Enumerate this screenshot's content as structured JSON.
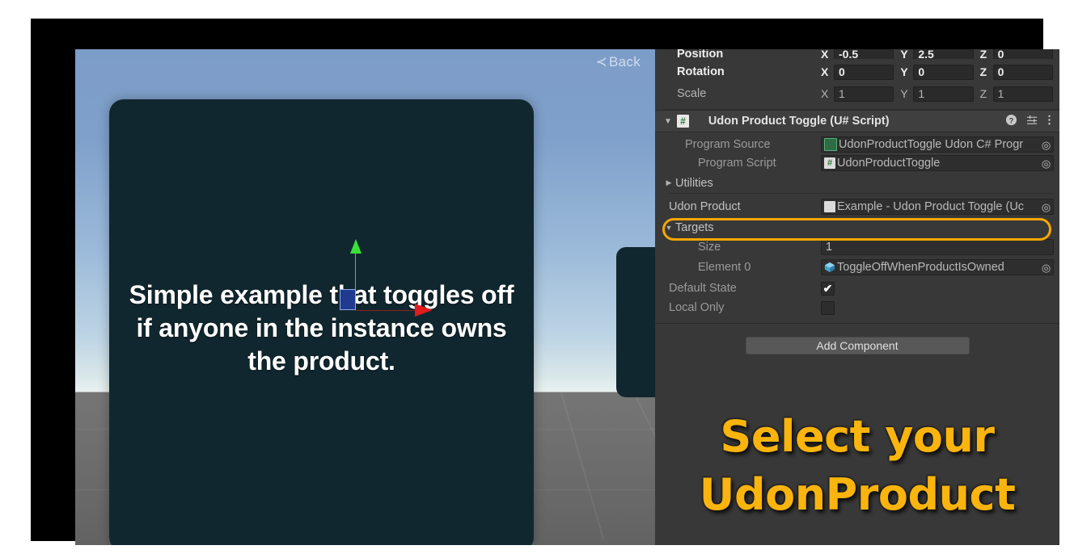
{
  "viewport": {
    "back_label": "Back",
    "back_chevron": "≺",
    "board_text": "Simple example that toggles off if anyone in the instance owns the product.",
    "gizmo": {
      "y_axis_color": "#3ae03a",
      "x_axis_color": "#e01c1c",
      "plane_color": "#1f3a8f"
    },
    "board_color": "#11272f",
    "sky_top_color": "#7d9dc9",
    "ground_color": "#6e6e6e"
  },
  "inspector": {
    "transform": {
      "rows": [
        {
          "label": "Rotation",
          "bold": true,
          "axes": [
            "X",
            "Y",
            "Z"
          ],
          "values": [
            "0",
            "0",
            "0"
          ]
        },
        {
          "label": "Scale",
          "bold": false,
          "axes": [
            "X",
            "Y",
            "Z"
          ],
          "values": [
            "1",
            "1",
            "1"
          ]
        }
      ]
    },
    "component": {
      "foldout": "▼",
      "icon_glyph": "#",
      "title": "Udon Product Toggle (U# Script)",
      "header_icons": [
        "help-icon",
        "preset-icon",
        "menu-icon"
      ]
    },
    "fields": {
      "program_source_label": "Program Source",
      "program_source_value": "UdonProductToggle Udon C# Progr",
      "program_script_label": "Program Script",
      "program_script_value": "UdonProductToggle",
      "utilities_label": "Utilities",
      "utilities_triangle": "▶",
      "udon_product_label": "Udon Product",
      "udon_product_value": "Example - Udon Product Toggle (Uc",
      "targets_label": "Targets",
      "targets_triangle": "▼",
      "size_label": "Size",
      "size_value": "1",
      "element0_label": "Element 0",
      "element0_value": "ToggleOffWhenProductIsOwned",
      "default_state_label": "Default State",
      "default_state_checked": "✔",
      "local_only_label": "Local Only",
      "local_only_checked": ""
    },
    "add_component_label": "Add Component",
    "highlight_color": "#f5a700",
    "background_color": "#383838",
    "seam_color": "#9a8fcd"
  },
  "callout": {
    "line1": "Select your",
    "line2": "UdonProduct",
    "color": "#f9b40d"
  }
}
